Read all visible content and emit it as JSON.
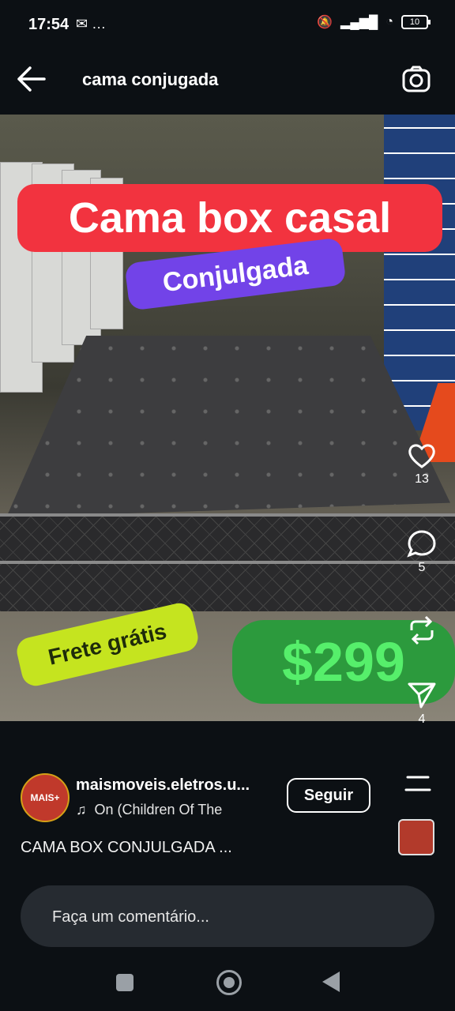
{
  "status_bar": {
    "time": "17:54",
    "extra": "…",
    "battery": "10"
  },
  "header": {
    "title": "cama conjugada"
  },
  "post": {
    "banner_title": "Cama box casal",
    "banner_subtitle": "Conjulgada",
    "shipping_label": "Frete grátis",
    "price": "$299"
  },
  "actions": {
    "like_count": "13",
    "comment_count": "5",
    "share_count": "4"
  },
  "profile": {
    "username": "maismoveis.eletros.u...",
    "music": "On (Children Of The",
    "follow_label": "Seguir",
    "avatar_text": "MAIS+"
  },
  "caption": "CAMA BOX CONJULGADA ...",
  "comment": {
    "placeholder": "Faça um comentário..."
  },
  "colors": {
    "banner_red": "#f2333f",
    "banner_purple": "#7243e8",
    "shipping_green": "#c5e41f",
    "price_green": "#2c9a3d"
  }
}
